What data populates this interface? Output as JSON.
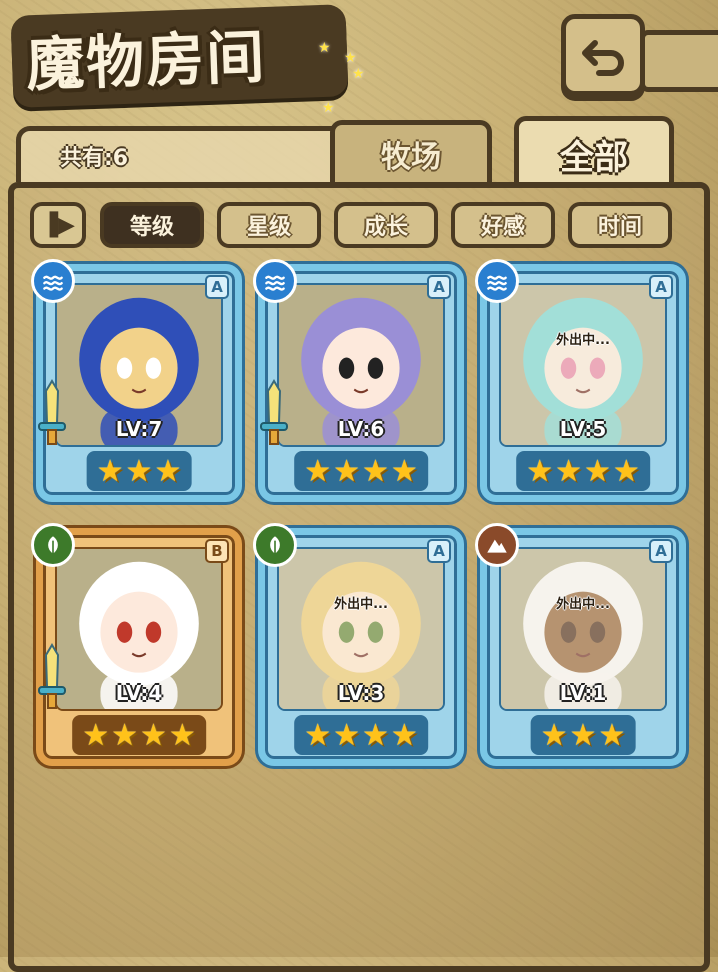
{
  "header": {
    "title": "魔物房间",
    "back_icon": "back-arrow-icon"
  },
  "count": {
    "label": "共有:6"
  },
  "tabs": [
    {
      "label": "牧场",
      "active": false
    },
    {
      "label": "全部",
      "active": true
    }
  ],
  "sort": {
    "toggle_icon": "sort-order-icon"
  },
  "filters": [
    {
      "label": "等级",
      "active": true
    },
    {
      "label": "星级",
      "active": false
    },
    {
      "label": "成长",
      "active": false
    },
    {
      "label": "好感",
      "active": false
    },
    {
      "label": "时间",
      "active": false
    }
  ],
  "monsters": [
    {
      "level": "LV:7",
      "rank": "A",
      "element": "water",
      "stars": 3,
      "away": "",
      "weapon": true,
      "frame": "blue"
    },
    {
      "level": "LV:6",
      "rank": "A",
      "element": "water",
      "stars": 4,
      "away": "",
      "weapon": true,
      "frame": "blue"
    },
    {
      "level": "LV:5",
      "rank": "A",
      "element": "water",
      "stars": 4,
      "away": "外出中...",
      "weapon": false,
      "frame": "blue"
    },
    {
      "level": "LV:4",
      "rank": "B",
      "element": "leaf",
      "stars": 4,
      "away": "",
      "weapon": true,
      "frame": "bronze"
    },
    {
      "level": "LV:3",
      "rank": "A",
      "element": "leaf",
      "stars": 4,
      "away": "外出中...",
      "weapon": false,
      "frame": "blue"
    },
    {
      "level": "LV:1",
      "rank": "A",
      "element": "earth",
      "stars": 3,
      "away": "外出中...",
      "weapon": false,
      "frame": "blue"
    }
  ],
  "colors": {
    "frame_blue": "#7ac7e6",
    "frame_bronze": "#e2a04a",
    "star": "#ffc21a",
    "ink": "#4a3a22"
  }
}
